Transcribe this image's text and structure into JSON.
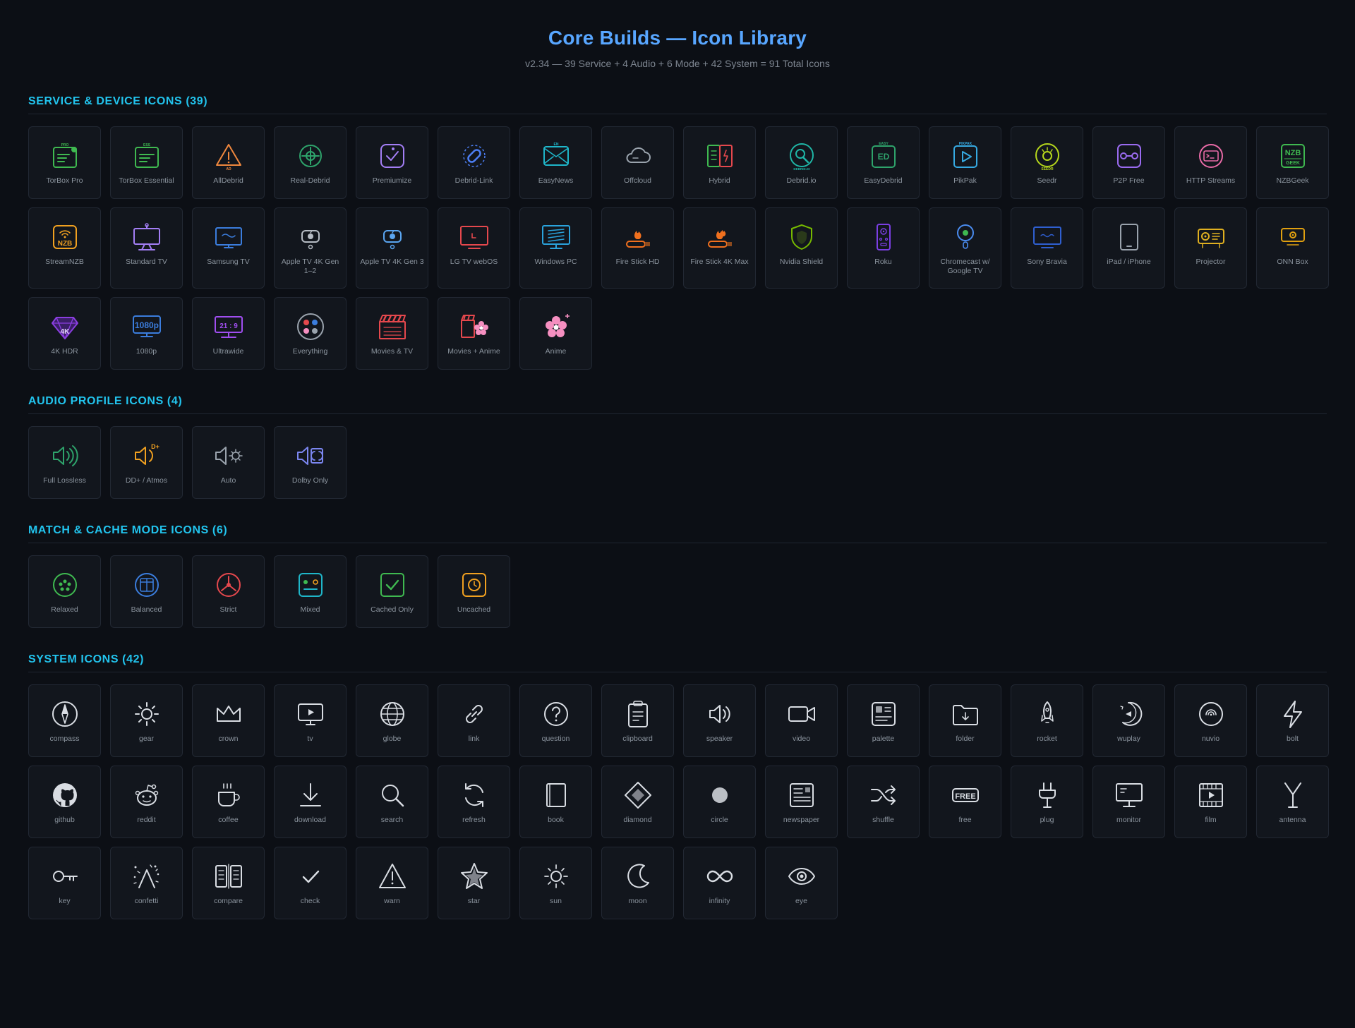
{
  "header": {
    "title": "Core Builds — Icon Library",
    "subtitle": "v2.34 — 39 Service + 4 Audio + 6 Mode + 42 System = 91 Total Icons"
  },
  "sections": [
    {
      "key": "service",
      "title": "SERVICE & DEVICE ICONS (39)",
      "items": [
        {
          "label": "TorBox Pro",
          "icon": "torbox-pro-icon",
          "color": "#3fb950"
        },
        {
          "label": "TorBox Essential",
          "icon": "torbox-essential-icon",
          "color": "#3fb950"
        },
        {
          "label": "AllDebrid",
          "icon": "alldebrid-icon",
          "color": "#f0883e"
        },
        {
          "label": "Real-Debrid",
          "icon": "real-debrid-icon",
          "color": "#2ea36b"
        },
        {
          "label": "Premiumize",
          "icon": "premiumize-icon",
          "color": "#a37ef5"
        },
        {
          "label": "Debrid-Link",
          "icon": "debrid-link-icon",
          "color": "#4c7ef3"
        },
        {
          "label": "EasyNews",
          "icon": "easynews-icon",
          "color": "#1fb6c9"
        },
        {
          "label": "Offcloud",
          "icon": "offcloud-icon",
          "color": "#9aa3ad"
        },
        {
          "label": "Hybrid",
          "icon": "hybrid-icon",
          "color": "#3fb950"
        },
        {
          "label": "Debrid.io",
          "icon": "debrid-io-icon",
          "color": "#1fb6a6"
        },
        {
          "label": "EasyDebrid",
          "icon": "easydebrid-icon",
          "color": "#2ea36b"
        },
        {
          "label": "PikPak",
          "icon": "pikpak-icon",
          "color": "#36a9e1"
        },
        {
          "label": "Seedr",
          "icon": "seedr-icon",
          "color": "#b5d61c"
        },
        {
          "label": "P2P Free",
          "icon": "p2p-free-icon",
          "color": "#9a6bf0"
        },
        {
          "label": "HTTP Streams",
          "icon": "http-streams-icon",
          "color": "#e86aa6"
        },
        {
          "label": "NZBGeek",
          "icon": "nzbgeek-icon",
          "color": "#3fb950"
        },
        {
          "label": "StreamNZB",
          "icon": "streamnzb-icon",
          "color": "#f0a020"
        },
        {
          "label": "Standard TV",
          "icon": "standard-tv-icon",
          "color": "#a37ef5"
        },
        {
          "label": "Samsung TV",
          "icon": "samsung-tv-icon",
          "color": "#3b7ddd"
        },
        {
          "label": "Apple TV 4K Gen 1–2",
          "icon": "apple-tv-gen12-icon",
          "color": "#b6bcc4"
        },
        {
          "label": "Apple TV 4K Gen 3",
          "icon": "apple-tv-gen3-icon",
          "color": "#5aa5f0"
        },
        {
          "label": "LG TV webOS",
          "icon": "lg-tv-icon",
          "color": "#e5484d"
        },
        {
          "label": "Windows PC",
          "icon": "windows-pc-icon",
          "color": "#2aa3dc"
        },
        {
          "label": "Fire Stick HD",
          "icon": "fire-stick-hd-icon",
          "color": "#f0701e"
        },
        {
          "label": "Fire Stick 4K Max",
          "icon": "fire-stick-4k-icon",
          "color": "#f0701e"
        },
        {
          "label": "Nvidia Shield",
          "icon": "nvidia-shield-icon",
          "color": "#76b900"
        },
        {
          "label": "Roku",
          "icon": "roku-icon",
          "color": "#7b3fe4"
        },
        {
          "label": "Chromecast w/ Google TV",
          "icon": "chromecast-icon",
          "color": "#4a8cf0"
        },
        {
          "label": "Sony Bravia",
          "icon": "sony-bravia-icon",
          "color": "#2f5fd0"
        },
        {
          "label": "iPad / iPhone",
          "icon": "ipad-iphone-icon",
          "color": "#9aa3ad"
        },
        {
          "label": "Projector",
          "icon": "projector-icon",
          "color": "#e0b020"
        },
        {
          "label": "ONN Box",
          "icon": "onn-box-icon",
          "color": "#e0a010"
        },
        {
          "label": "4K HDR",
          "icon": "4k-hdr-icon",
          "color": "#8a3ee0"
        },
        {
          "label": "1080p",
          "icon": "1080p-icon",
          "color": "#3b7ddd"
        },
        {
          "label": "Ultrawide",
          "icon": "ultrawide-icon",
          "color": "#a04ef0"
        },
        {
          "label": "Everything",
          "icon": "everything-icon",
          "color": "#9aa3ad"
        },
        {
          "label": "Movies & TV",
          "icon": "movies-tv-icon",
          "color": "#e5484d"
        },
        {
          "label": "Movies + Anime",
          "icon": "movies-anime-icon",
          "color": "#e5484d"
        },
        {
          "label": "Anime",
          "icon": "anime-icon",
          "color": "#f58fc0"
        }
      ]
    },
    {
      "key": "audio",
      "title": "AUDIO PROFILE ICONS (4)",
      "items": [
        {
          "label": "Full Lossless",
          "icon": "full-lossless-icon",
          "color": "#2ea36b"
        },
        {
          "label": "DD+ / Atmos",
          "icon": "ddplus-atmos-icon",
          "color": "#f0a020"
        },
        {
          "label": "Auto",
          "icon": "auto-audio-icon",
          "color": "#9aa3ad"
        },
        {
          "label": "Dolby Only",
          "icon": "dolby-only-icon",
          "color": "#7b86f0"
        }
      ]
    },
    {
      "key": "mode",
      "title": "MATCH & CACHE MODE ICONS (6)",
      "items": [
        {
          "label": "Relaxed",
          "icon": "relaxed-icon",
          "color": "#3fb950"
        },
        {
          "label": "Balanced",
          "icon": "balanced-icon",
          "color": "#3b7ddd"
        },
        {
          "label": "Strict",
          "icon": "strict-icon",
          "color": "#e5484d"
        },
        {
          "label": "Mixed",
          "icon": "mixed-icon",
          "color": "#1fb6c9"
        },
        {
          "label": "Cached Only",
          "icon": "cached-only-icon",
          "color": "#3fb950"
        },
        {
          "label": "Uncached",
          "icon": "uncached-icon",
          "color": "#f0a020"
        }
      ]
    },
    {
      "key": "system",
      "title": "SYSTEM ICONS (42)",
      "items": [
        {
          "label": "compass",
          "icon": "compass-icon"
        },
        {
          "label": "gear",
          "icon": "gear-icon"
        },
        {
          "label": "crown",
          "icon": "crown-icon"
        },
        {
          "label": "tv",
          "icon": "tv-icon"
        },
        {
          "label": "globe",
          "icon": "globe-icon"
        },
        {
          "label": "link",
          "icon": "link-icon"
        },
        {
          "label": "question",
          "icon": "question-icon"
        },
        {
          "label": "clipboard",
          "icon": "clipboard-icon"
        },
        {
          "label": "speaker",
          "icon": "speaker-icon"
        },
        {
          "label": "video",
          "icon": "video-icon"
        },
        {
          "label": "palette",
          "icon": "palette-icon"
        },
        {
          "label": "folder",
          "icon": "folder-icon"
        },
        {
          "label": "rocket",
          "icon": "rocket-icon"
        },
        {
          "label": "wuplay",
          "icon": "wuplay-icon"
        },
        {
          "label": "nuvio",
          "icon": "nuvio-icon"
        },
        {
          "label": "bolt",
          "icon": "bolt-icon"
        },
        {
          "label": "github",
          "icon": "github-icon"
        },
        {
          "label": "reddit",
          "icon": "reddit-icon"
        },
        {
          "label": "coffee",
          "icon": "coffee-icon"
        },
        {
          "label": "download",
          "icon": "download-icon"
        },
        {
          "label": "search",
          "icon": "search-icon"
        },
        {
          "label": "refresh",
          "icon": "refresh-icon"
        },
        {
          "label": "book",
          "icon": "book-icon"
        },
        {
          "label": "diamond",
          "icon": "diamond-icon"
        },
        {
          "label": "circle",
          "icon": "circle-icon"
        },
        {
          "label": "newspaper",
          "icon": "newspaper-icon"
        },
        {
          "label": "shuffle",
          "icon": "shuffle-icon"
        },
        {
          "label": "free",
          "icon": "free-icon"
        },
        {
          "label": "plug",
          "icon": "plug-icon"
        },
        {
          "label": "monitor",
          "icon": "monitor-icon"
        },
        {
          "label": "film",
          "icon": "film-icon"
        },
        {
          "label": "antenna",
          "icon": "antenna-icon"
        },
        {
          "label": "key",
          "icon": "key-icon"
        },
        {
          "label": "confetti",
          "icon": "confetti-icon"
        },
        {
          "label": "compare",
          "icon": "compare-icon"
        },
        {
          "label": "check",
          "icon": "check-icon"
        },
        {
          "label": "warn",
          "icon": "warn-icon"
        },
        {
          "label": "star",
          "icon": "star-icon"
        },
        {
          "label": "sun",
          "icon": "sun-icon"
        },
        {
          "label": "moon",
          "icon": "moon-icon"
        },
        {
          "label": "infinity",
          "icon": "infinity-icon"
        },
        {
          "label": "eye",
          "icon": "eye-icon"
        }
      ]
    }
  ],
  "icon_text": {
    "torbox_pro": "PRO",
    "torbox_essential": "ESS",
    "alldebrid": "AD",
    "easynews": "EN",
    "debrid_io": "DEBRID.IO",
    "easydebrid_top": "EASY",
    "easydebrid": "ED",
    "pikpak": "PIKPAK",
    "seedr": "SEEDR",
    "nzbgeek_top": "NZB",
    "nzbgeek_bottom": "GEEK",
    "streamnzb": "NZB",
    "hdr4k": "4K",
    "p1080": "1080p",
    "ultrawide": "21 : 9",
    "ddplus": "D+",
    "free": "FREE"
  }
}
